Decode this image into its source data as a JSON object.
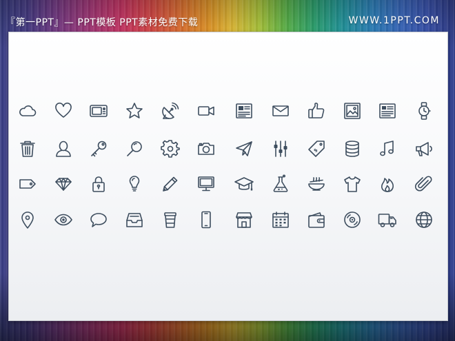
{
  "header": {
    "left_title": "『第一PPT』— PPT模板 PPT素材免费下载",
    "right_url": "WWW.1PPT.COM"
  },
  "icon_grid": {
    "icon_color": "#3d4d5e",
    "rows": [
      [
        "cloud-icon",
        "heart-icon",
        "tv-icon",
        "star-icon",
        "satellite-dish-icon",
        "video-camera-icon",
        "newspaper-icon",
        "envelope-icon",
        "thumbs-up-icon",
        "picture-icon",
        "document-icon",
        "wristwatch-icon"
      ],
      [
        "trash-icon",
        "user-icon",
        "key-icon",
        "magnifier-icon",
        "gear-icon",
        "camera-icon",
        "paper-plane-icon",
        "equalizer-icon",
        "price-tag-icon",
        "database-icon",
        "music-note-icon",
        "megaphone-icon"
      ],
      [
        "tag-icon",
        "diamond-icon",
        "padlock-icon",
        "lightbulb-icon",
        "pencil-icon",
        "monitor-icon",
        "graduation-cap-icon",
        "flask-icon",
        "noodle-bowl-icon",
        "t-shirt-icon",
        "fire-icon",
        "paperclip-icon"
      ],
      [
        "map-pin-icon",
        "eye-icon",
        "speech-bubble-icon",
        "inbox-tray-icon",
        "coffee-cup-icon",
        "smartphone-icon",
        "storefront-icon",
        "calendar-icon",
        "wallet-icon",
        "compact-disc-icon",
        "delivery-truck-icon",
        "globe-icon"
      ]
    ]
  }
}
